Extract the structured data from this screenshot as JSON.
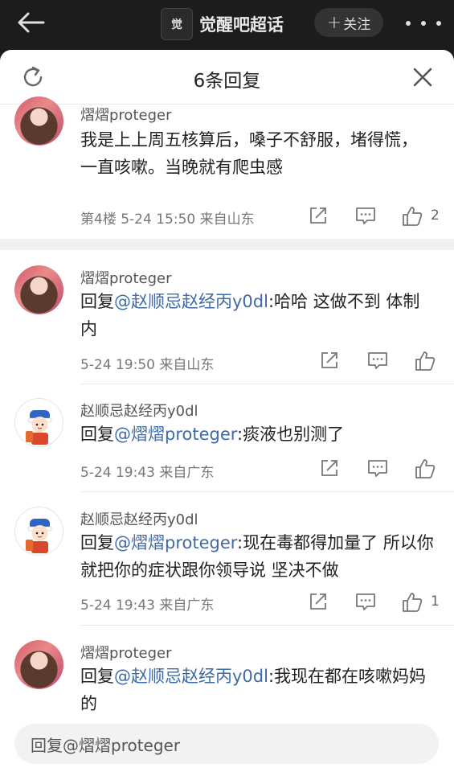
{
  "topbar": {
    "topic_logo_text": "觉",
    "topic_title": "觉醒吧超话",
    "follow_label": "关注"
  },
  "sheet": {
    "title": "6条回复"
  },
  "comments": [
    {
      "username": "熠熠proteger",
      "text_plain": "我是上上周五核算后，嗓子不舒服，堵得慌，一直咳嗽。当晚就有爬虫感",
      "meta": "第4楼  5-24 15:50  来自山东",
      "likes": "2"
    },
    {
      "username": "熠熠proteger",
      "reply_prefix": "回复",
      "mention": "@赵顺忌赵经丙y0dl",
      "text": ":哈哈 这做不到 体制内",
      "meta": "5-24 19:50  来自山东",
      "likes": ""
    },
    {
      "username": "赵顺忌赵经丙y0dl",
      "reply_prefix": "回复",
      "mention": "@熠熠proteger",
      "text": ":痰液也别测了",
      "meta": "5-24 19:43  来自广东",
      "likes": ""
    },
    {
      "username": "赵顺忌赵经丙y0dl",
      "reply_prefix": "回复",
      "mention": "@熠熠proteger",
      "text": ":现在毒都得加量了 所以你就把你的症状跟你领导说 坚决不做",
      "meta": "5-24 19:43  来自广东",
      "likes": "1"
    },
    {
      "username": "熠熠proteger",
      "reply_prefix": "回复",
      "mention": "@赵顺忌赵经丙y0dl",
      "text": ":我现在都在咳嗽妈妈的",
      "meta": "",
      "likes": ""
    }
  ],
  "reply_input": {
    "placeholder": "回复@熠熠proteger"
  },
  "colors": {
    "mention": "#3f6aa8",
    "topbar_bg": "#1c1c1c"
  },
  "icons": [
    "back-arrow-icon",
    "refresh-icon",
    "close-icon",
    "share-icon",
    "comment-icon",
    "thumbs-up-icon",
    "more-dots-icon"
  ]
}
